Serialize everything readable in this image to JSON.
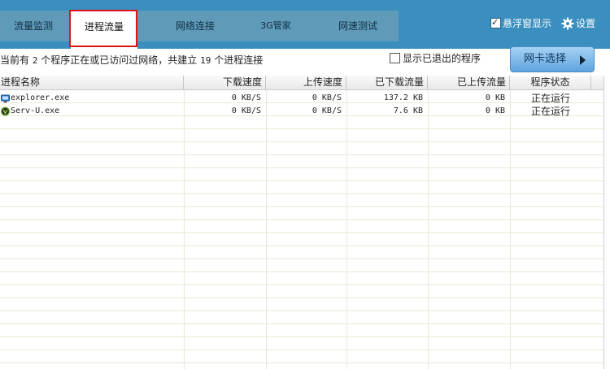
{
  "tabs": [
    {
      "label": "流量监测"
    },
    {
      "label": "进程流量",
      "active": true
    },
    {
      "label": "网络连接"
    },
    {
      "label": "3G管家"
    },
    {
      "label": "网速测试"
    }
  ],
  "toolbar": {
    "float_window_label": "悬浮窗显示",
    "float_window_checked": true,
    "settings_label": "设置"
  },
  "summary": {
    "prefix": "当前有",
    "process_count": "2",
    "middle": "个程序正在或已访问过网络，共建立",
    "connection_count": "19",
    "suffix": "个进程连接"
  },
  "show_exited": {
    "label": "显示已退出的程序",
    "checked": false
  },
  "nic_button": {
    "label": "网卡选择"
  },
  "table": {
    "columns": [
      "进程名称",
      "下载速度",
      "上传速度",
      "已下载流量",
      "已上传流量",
      "程序状态"
    ],
    "rows": [
      {
        "icon": "explorer-icon",
        "name": "explorer.exe",
        "down_speed": "0 KB/S",
        "up_speed": "0 KB/S",
        "downloaded": "137.2 KB",
        "uploaded": "0 KB",
        "status": "正在运行"
      },
      {
        "icon": "serv-u-icon",
        "name": "Serv-U.exe",
        "down_speed": "0 KB/S",
        "up_speed": "0 KB/S",
        "downloaded": "7.6 KB",
        "uploaded": "0 KB",
        "status": "正在运行"
      }
    ]
  },
  "colors": {
    "topbar": "#3b8fbf",
    "tabstrip": "#5f9ab8",
    "highlight": "#e01414",
    "grid": "#e6ead6"
  }
}
